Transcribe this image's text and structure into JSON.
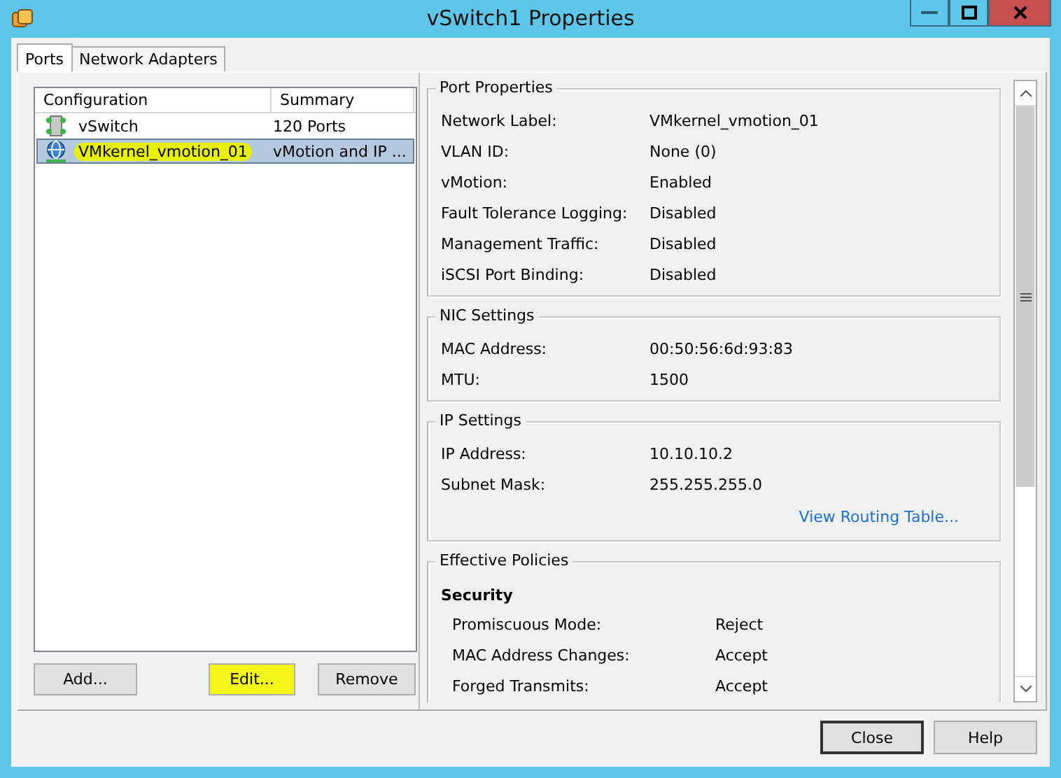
{
  "window": {
    "title": "vSwitch1 Properties"
  },
  "tabs": [
    {
      "label": "Ports",
      "selected": true
    },
    {
      "label": "Network Adapters",
      "selected": false
    }
  ],
  "list": {
    "columns": [
      "Configuration",
      "Summary"
    ],
    "rows": [
      {
        "kind": "switch",
        "name": "vSwitch",
        "summary": "120 Ports",
        "selected": false,
        "highlighted": false
      },
      {
        "kind": "vmkernel",
        "name": "VMkernel_vmotion_01",
        "summary": "vMotion and IP ...",
        "selected": true,
        "highlighted": true
      }
    ]
  },
  "list_buttons": [
    {
      "label": "Add...",
      "highlighted": false
    },
    {
      "label": "Edit...",
      "highlighted": true
    },
    {
      "label": "Remove",
      "highlighted": false
    }
  ],
  "groups": [
    {
      "title": "Port Properties",
      "rows": [
        {
          "label": "Network Label:",
          "value": "VMkernel_vmotion_01"
        },
        {
          "label": "VLAN ID:",
          "value": "None (0)"
        },
        {
          "label": "vMotion:",
          "value": "Enabled"
        },
        {
          "label": "Fault Tolerance Logging:",
          "value": "Disabled"
        },
        {
          "label": "Management Traffic:",
          "value": "Disabled"
        },
        {
          "label": "iSCSI Port Binding:",
          "value": "Disabled"
        }
      ]
    },
    {
      "title": "NIC Settings",
      "rows": [
        {
          "label": "MAC Address:",
          "value": "00:50:56:6d:93:83"
        },
        {
          "label": "MTU:",
          "value": "1500"
        }
      ]
    },
    {
      "title": "IP Settings",
      "rows": [
        {
          "label": "IP Address:",
          "value": "10.10.10.2"
        },
        {
          "label": "Subnet Mask:",
          "value": "255.255.255.0"
        }
      ],
      "link": "View Routing Table..."
    },
    {
      "title": "Effective Policies",
      "subheading": "Security",
      "rows": [
        {
          "label": "Promiscuous Mode:",
          "value": "Reject"
        },
        {
          "label": "MAC Address Changes:",
          "value": "Accept"
        },
        {
          "label": "Forged Transmits:",
          "value": "Accept"
        }
      ]
    }
  ],
  "dialog_buttons": [
    {
      "label": "Close",
      "default": true
    },
    {
      "label": "Help",
      "default": false
    }
  ]
}
